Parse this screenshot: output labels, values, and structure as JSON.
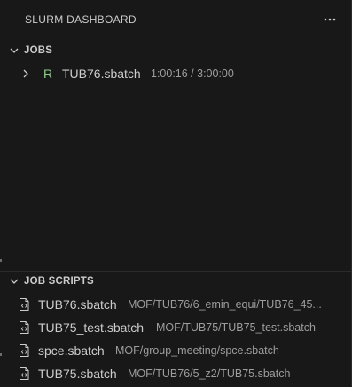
{
  "panel": {
    "title": "SLURM DASHBOARD",
    "more_icon": "ellipsis-icon"
  },
  "jobs_section": {
    "title": "JOBS",
    "expanded": true,
    "jobs": [
      {
        "status": "R",
        "status_color": "#89d185",
        "name": "TUB76.sbatch",
        "time": "1:00:16 / 3:00:00"
      }
    ]
  },
  "scripts_section": {
    "title": "JOB SCRIPTS",
    "expanded": true,
    "scripts": [
      {
        "name": "TUB76.sbatch",
        "path": "MOF/TUB76/6_emin_equi/TUB76_45..."
      },
      {
        "name": "TUB75_test.sbatch",
        "path": "MOF/TUB75/TUB75_test.sbatch"
      },
      {
        "name": "spce.sbatch",
        "path": "MOF/group_meeting/spce.sbatch"
      },
      {
        "name": "TUB75.sbatch",
        "path": "MOF/TUB76/5_z2/TUB75.sbatch"
      }
    ]
  }
}
